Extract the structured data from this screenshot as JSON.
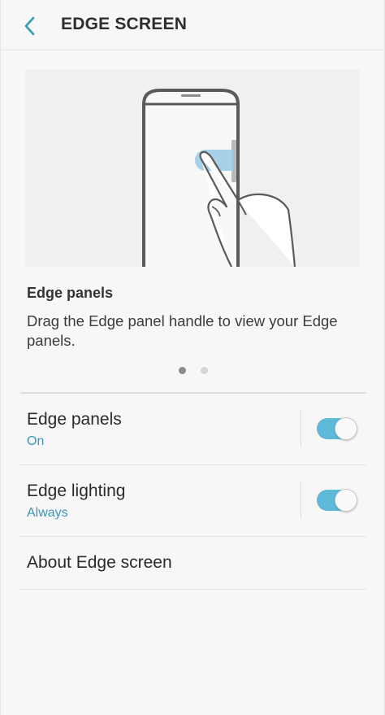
{
  "header": {
    "title": "EDGE SCREEN",
    "back_icon": "chevron-left-icon",
    "accent_color": "#3a97b8"
  },
  "intro": {
    "title": "Edge panels",
    "description": "Drag the Edge panel handle to view your Edge panels.",
    "page_indicator": {
      "current": 1,
      "total": 2
    }
  },
  "settings": [
    {
      "title": "Edge panels",
      "subtitle": "On",
      "toggle_on": true
    },
    {
      "title": "Edge lighting",
      "subtitle": "Always",
      "toggle_on": true
    },
    {
      "title": "About Edge screen"
    }
  ],
  "colors": {
    "background": "#f7f7f7",
    "toggle_on": "#5cb9d8",
    "subtitle": "#3a97b8"
  }
}
